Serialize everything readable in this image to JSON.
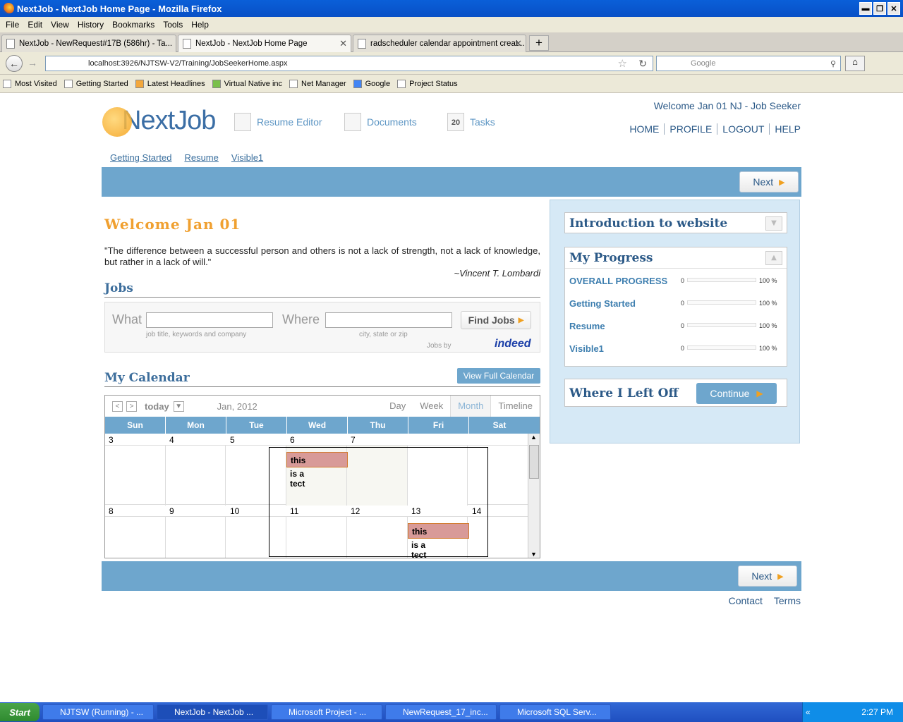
{
  "window": {
    "title": "NextJob - NextJob Home Page - Mozilla Firefox"
  },
  "menu": [
    "File",
    "Edit",
    "View",
    "History",
    "Bookmarks",
    "Tools",
    "Help"
  ],
  "tabs": [
    {
      "label": "NextJob - NewRequest#17B (586hr) - Ta..."
    },
    {
      "label": "NextJob - NextJob Home Page"
    },
    {
      "label": "radscheduler calendar appointment creat..."
    }
  ],
  "url": "localhost:3926/NJTSW-V2/Training/JobSeekerHome.aspx",
  "search_placeholder": "Google",
  "bookmarks": [
    "Most Visited",
    "Getting Started",
    "Latest Headlines",
    "Virtual Native inc",
    "Net Manager",
    "Google",
    "Project Status"
  ],
  "site": {
    "logo": "NextJob",
    "topnav": [
      "Resume Editor",
      "Documents",
      "Tasks"
    ],
    "tasks_badge": "20",
    "welcome_user": "Welcome Jan 01 NJ - Job Seeker",
    "toplinks": [
      "HOME",
      "PROFILE",
      "LOGOUT",
      "HELP"
    ],
    "subnav": [
      "Getting Started",
      "Resume",
      "Visible1"
    ],
    "next_label": "Next"
  },
  "main": {
    "welcome": "Welcome Jan 01",
    "quote": "\"The difference between a successful person and others is not a lack of strength, not a lack of knowledge, but rather in a lack of will.\"",
    "author": "~Vincent T. Lombardi",
    "jobs_heading": "Jobs",
    "what_label": "What",
    "what_hint": "job title, keywords and company",
    "where_label": "Where",
    "where_hint": "city, state or zip",
    "find_jobs": "Find Jobs",
    "jobs_by": "Jobs by",
    "indeed": "indeed",
    "calendar_heading": "My Calendar",
    "view_full_calendar": "View Full Calendar"
  },
  "calendar": {
    "today": "today",
    "period": "Jan, 2012",
    "views": [
      "Day",
      "Week",
      "Month",
      "Timeline"
    ],
    "active_view": "Month",
    "weekdays": [
      "Sun",
      "Mon",
      "Tue",
      "Wed",
      "Thu",
      "Fri",
      "Sat"
    ],
    "weeks": [
      {
        "days": [
          "3",
          "4",
          "5",
          "6",
          "7"
        ]
      },
      {
        "days": [
          "8",
          "9",
          "10",
          "11",
          "12",
          "13",
          "14"
        ]
      }
    ],
    "events": [
      {
        "line1": "this",
        "line2": "is a",
        "line3": "tect"
      },
      {
        "line1": "this",
        "line2": "is a",
        "line3": "tect"
      }
    ]
  },
  "sidebar": {
    "intro_title": "Introduction to website",
    "progress_title": "My Progress",
    "progress": [
      {
        "label": "OVERALL PROGRESS",
        "min": "0",
        "max": "100 %",
        "value": 0
      },
      {
        "label": "Getting Started",
        "min": "0",
        "max": "100 %",
        "value": 0
      },
      {
        "label": "Resume",
        "min": "0",
        "max": "100 %",
        "value": 0
      },
      {
        "label": "Visible1",
        "min": "0",
        "max": "100 %",
        "value": 0
      }
    ],
    "left_off_title": "Where I Left Off",
    "continue_label": "Continue"
  },
  "footer": [
    "Contact",
    "Terms"
  ],
  "taskbar": {
    "start": "Start",
    "items": [
      "NJTSW (Running) - ...",
      "NextJob - NextJob ...",
      "Microsoft Project - ...",
      "NewRequest_17_inc...",
      "Microsoft SQL Serv..."
    ],
    "clock": "2:27 PM"
  }
}
